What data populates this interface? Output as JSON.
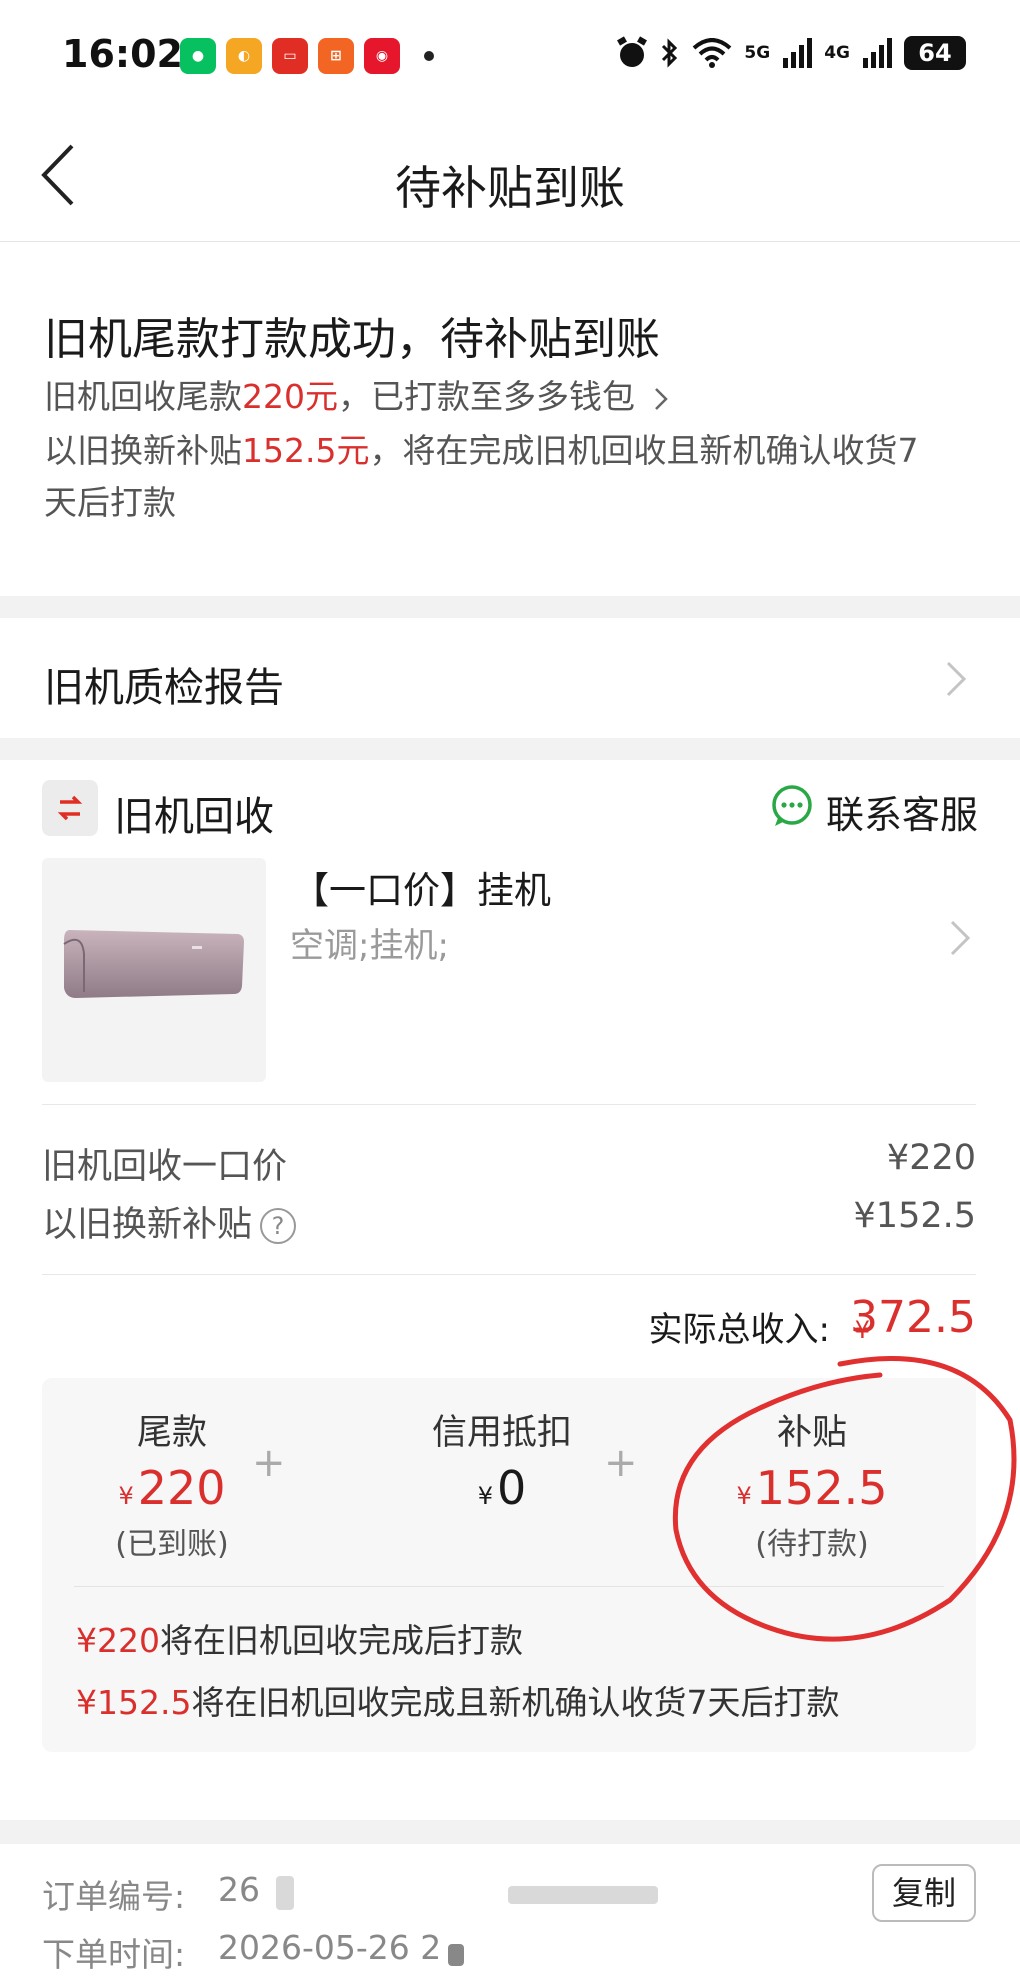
{
  "status_bar": {
    "time": "16:02",
    "signal_5g": "5G",
    "signal_4g": "4G",
    "battery": "64"
  },
  "nav": {
    "title": "待补贴到账"
  },
  "status": {
    "headline": "旧机尾款打款成功，待补贴到账",
    "line1_prefix": "旧机回收尾款",
    "line1_amount": "220元",
    "line1_suffix": "，已打款至多多钱包",
    "line2_prefix": "以旧换新补贴",
    "line2_amount": "152.5元",
    "line2_suffix": "，将在完成旧机回收且新机确认收货7",
    "line2_wrap": "天后打款"
  },
  "report": {
    "label": "旧机质检报告"
  },
  "order": {
    "section_label": "旧机回收",
    "customer_service": "联系客服",
    "product_title": "【一口价】挂机",
    "product_spec": "空调;挂机;",
    "price_label": "旧机回收一口价",
    "price_value": "¥220",
    "subsidy_label": "以旧换新补贴",
    "subsidy_value": "¥152.5",
    "total_label": "实际总收入:",
    "total_currency": "¥",
    "total_value": "372.5"
  },
  "breakdown": {
    "currency": "¥",
    "plus": "+",
    "items": [
      {
        "title": "尾款",
        "amount": "220",
        "note": "(已到账)"
      },
      {
        "title": "信用抵扣",
        "amount": "0",
        "note": ""
      },
      {
        "title": "补贴",
        "amount": "152.5",
        "note": "(待打款)"
      }
    ],
    "line1_amount": "¥220",
    "line1_text": "将在旧机回收完成后打款",
    "line2_amount": "¥152.5",
    "line2_text": "将在旧机回收完成且新机确认收货7天后打款"
  },
  "footer": {
    "order_no_label": "订单编号:",
    "order_no_value": "26",
    "order_time_label": "下单时间:",
    "order_time_value": "2026-05-26 2",
    "copy_label": "复制"
  },
  "colors": {
    "accent_red": "#d9302e",
    "annotation_red": "#e03030"
  }
}
